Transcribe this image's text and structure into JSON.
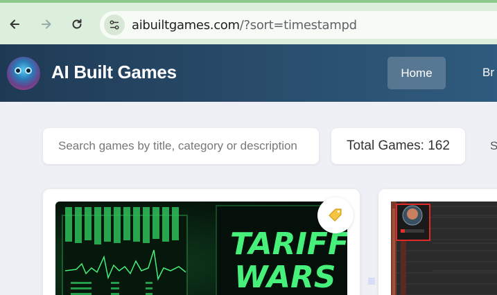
{
  "browser": {
    "url_host": "aibuiltgames.com",
    "url_path": "/?sort=timestampd"
  },
  "header": {
    "title": "AI Built Games",
    "nav": [
      {
        "label": "Home",
        "active": true
      },
      {
        "label": "Br"
      }
    ]
  },
  "search": {
    "placeholder": "Search games by title, category or description"
  },
  "stats": {
    "total_games_text": "Total Games: 162",
    "sort_label_partial": "S"
  },
  "cards": [
    {
      "thumbnail_text_line1": "TARIFF",
      "thumbnail_text_line2": "WARS",
      "badge_icon": "tag-icon"
    },
    {
      "thumbnail": "dungeon-game"
    }
  ],
  "colors": {
    "browser_bar": "#dcefdc",
    "header_bg": "#2a4f6e",
    "page_bg": "#eef0f5",
    "neon_green": "#46f07a"
  }
}
